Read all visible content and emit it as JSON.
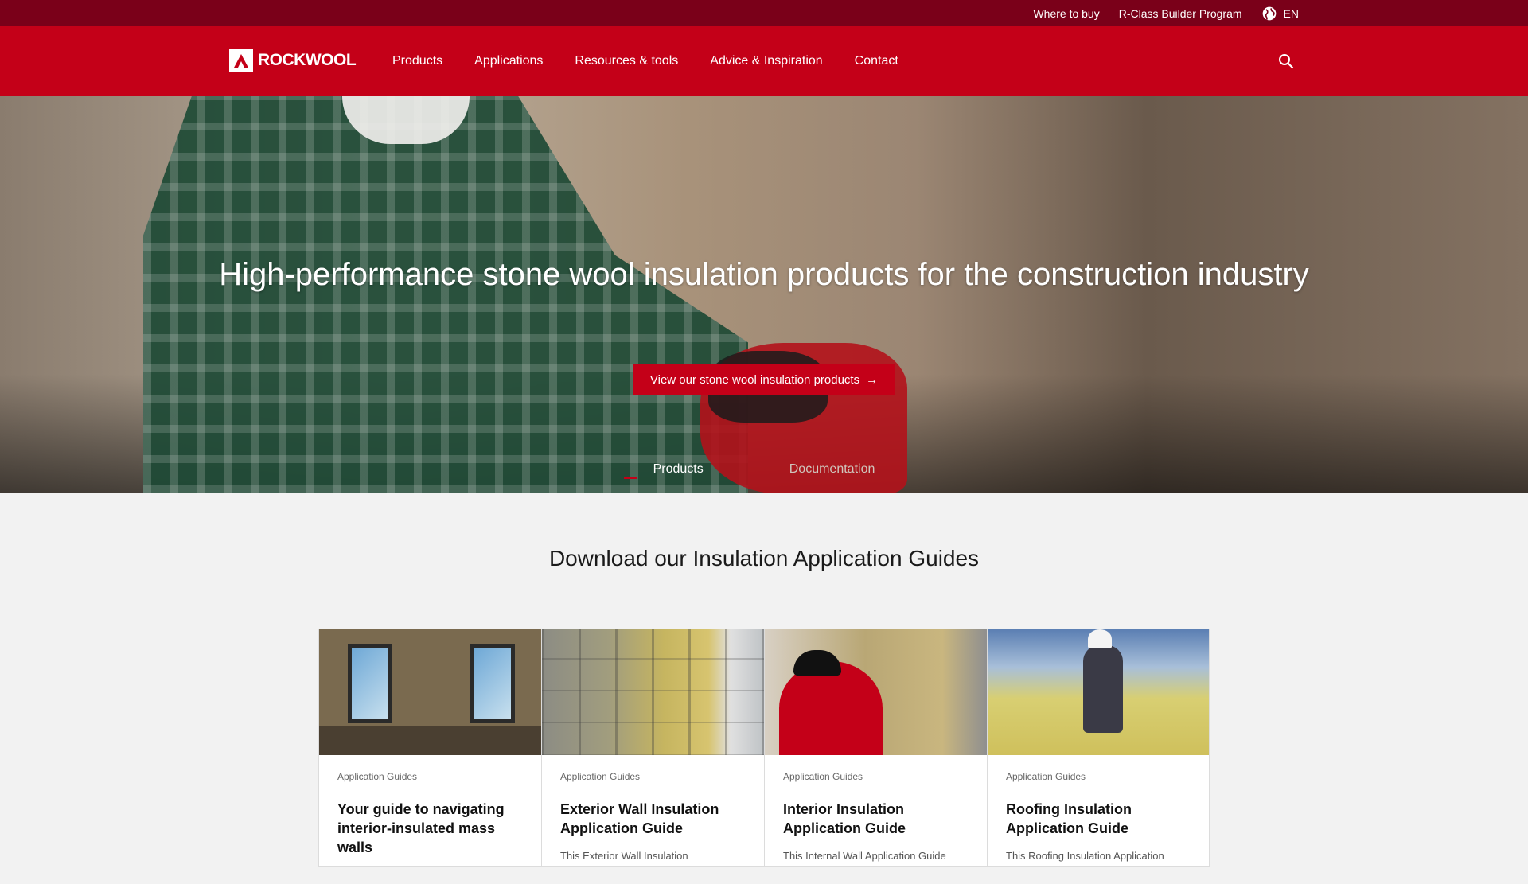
{
  "utility_bar": {
    "where_to_buy": "Where to buy",
    "builder_program": "R-Class Builder Program",
    "language": "EN"
  },
  "nav": {
    "logo_text": "ROCKWOOL",
    "links": [
      "Products",
      "Applications",
      "Resources & tools",
      "Advice & Inspiration",
      "Contact"
    ]
  },
  "hero": {
    "title": "High-performance stone wool insulation products for the construction industry",
    "cta_label": "View our stone wool insulation products",
    "cta_arrow": "→",
    "tabs": [
      "Products",
      "Documentation"
    ]
  },
  "guides": {
    "title": "Download our Insulation Application Guides",
    "cards": [
      {
        "category": "Application Guides",
        "title": "Your guide to navigating interior-insulated mass walls",
        "description": ""
      },
      {
        "category": "Application Guides",
        "title": "Exterior Wall Insulation Application Guide",
        "description": "This Exterior Wall Insulation"
      },
      {
        "category": "Application Guides",
        "title": "Interior Insulation Application Guide",
        "description": "This Internal Wall Application Guide"
      },
      {
        "category": "Application Guides",
        "title": "Roofing Insulation Application Guide",
        "description": "This Roofing Insulation Application"
      }
    ]
  },
  "colors": {
    "utility_bar": "#7a0019",
    "nav": "#c40018",
    "accent": "#c40018"
  }
}
